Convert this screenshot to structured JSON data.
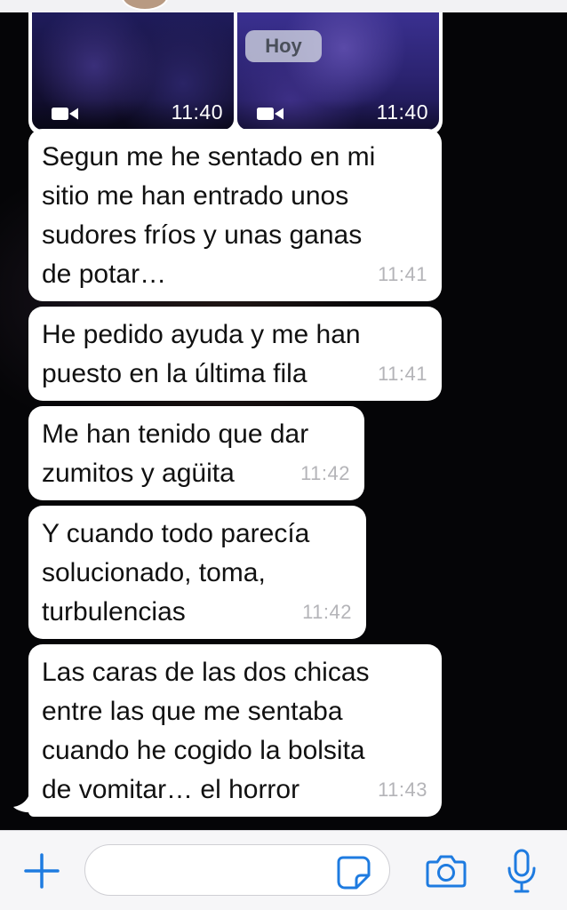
{
  "colors": {
    "accent": "#1e7be0",
    "bubble_incoming": "#ffffff",
    "timestamp": "#b4b4b8",
    "chat_background": "#050507"
  },
  "date_chip": "Hoy",
  "media_message": {
    "videos": [
      {
        "icon": "video-camera-icon",
        "time": "11:40"
      },
      {
        "icon": "video-camera-icon",
        "time": "11:40"
      }
    ]
  },
  "messages": [
    {
      "text": "Segun me he sentado en mi\nsitio me han entrado unos\nsudores fríos y unas ganas\nde potar…",
      "time": "11:41"
    },
    {
      "text": "He pedido ayuda y me han\npuesto en la última fila",
      "time": "11:41"
    },
    {
      "text": "Me han tenido que dar\nzumitos y agüita",
      "time": "11:42"
    },
    {
      "text": "Y cuando todo parecía\nsolucionado, toma,\nturbulencias",
      "time": "11:42"
    },
    {
      "text": "Las caras de las dos chicas\nentre las que me sentaba\ncuando he cogido la bolsita\nde vomitar… el horror",
      "time": "11:43"
    }
  ],
  "input_bar": {
    "placeholder": "",
    "icons": [
      "plus-icon",
      "sticker-icon",
      "camera-icon",
      "microphone-icon"
    ]
  }
}
